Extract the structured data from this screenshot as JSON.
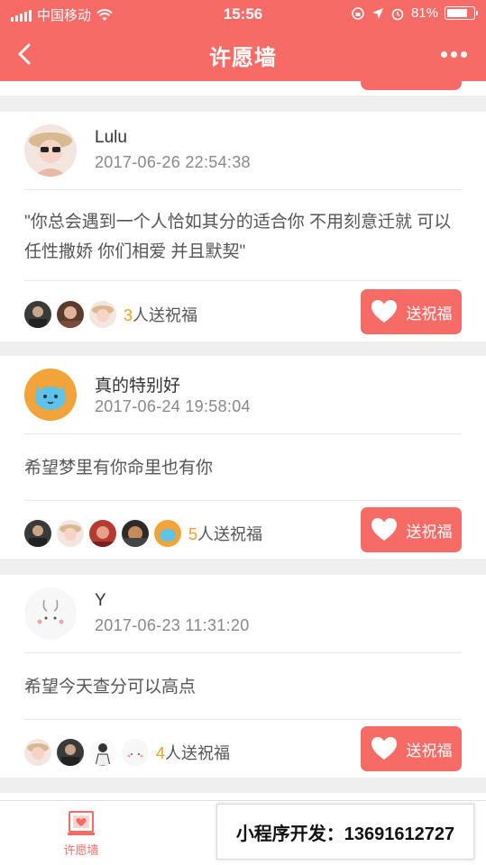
{
  "status_bar": {
    "carrier": "中国移动",
    "time": "15:56",
    "battery": "81%",
    "battery_level": 0.81
  },
  "nav": {
    "title": "许愿墙"
  },
  "wishes": [
    {
      "name": "Lulu",
      "date": "2017-06-26 22:54:38",
      "message": "\"你总会遇到一个人恰如其分的适合你 不用刻意迁就 可以任性撒娇 你们相爱 并且默契\"",
      "bless_count": "3",
      "bless_suffix": "人送祝福",
      "bless_button": "送祝福"
    },
    {
      "name": "真的特别好",
      "date": "2017-06-24 19:58:04",
      "message": "希望梦里有你命里也有你",
      "bless_count": "5",
      "bless_suffix": "人送祝福",
      "bless_button": "送祝福"
    },
    {
      "name": "Y",
      "date": "2017-06-23 11:31:20",
      "message": "希望今天查分可以高点",
      "bless_count": "4",
      "bless_suffix": "人送祝福",
      "bless_button": "送祝福"
    }
  ],
  "tabbar": {
    "tab_label": "许愿墙"
  },
  "promo": {
    "text": "小程序开发：13691612727"
  },
  "colors": {
    "accent": "#f76b66",
    "count_highlight": "#f0a024"
  }
}
